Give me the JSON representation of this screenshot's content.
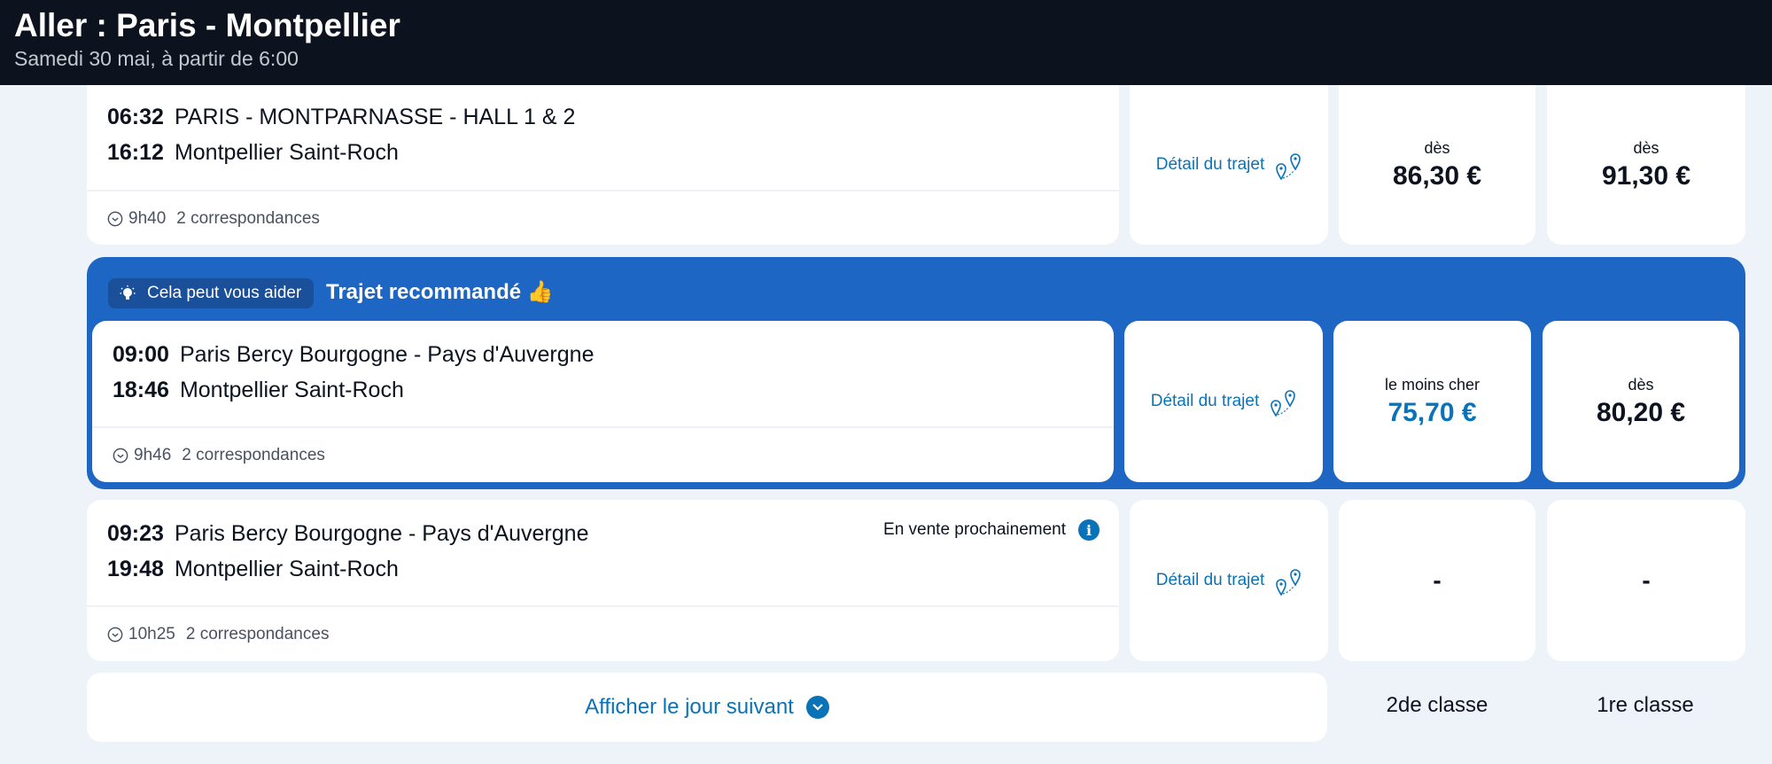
{
  "header": {
    "title": "Aller : Paris - Montpellier",
    "subtitle": "Samedi 30 mai, à partir de 6:00"
  },
  "journeys": [
    {
      "depart_time": "06:32",
      "depart_station": "PARIS - MONTPARNASSE - HALL 1 & 2",
      "arrive_time": "16:12",
      "arrive_station": "Montpellier Saint-Roch",
      "duration": "9h40",
      "connections": "2 correspondances",
      "detail_label": "Détail du trajet",
      "price_2nd": {
        "label": "dès",
        "amount": "86,30 €"
      },
      "price_1st": {
        "label": "dès",
        "amount": "91,30 €"
      }
    },
    {
      "depart_time": "09:00",
      "depart_station": "Paris Bercy Bourgogne - Pays d'Auvergne",
      "arrive_time": "18:46",
      "arrive_station": "Montpellier Saint-Roch",
      "duration": "9h46",
      "connections": "2 correspondances",
      "detail_label": "Détail du trajet",
      "price_2nd": {
        "label": "le moins cher",
        "amount": "75,70 €"
      },
      "price_1st": {
        "label": "dès",
        "amount": "80,20 €"
      }
    },
    {
      "depart_time": "09:23",
      "depart_station": "Paris Bercy Bourgogne - Pays d'Auvergne",
      "arrive_time": "19:48",
      "arrive_station": "Montpellier Saint-Roch",
      "duration": "10h25",
      "connections": "2 correspondances",
      "detail_label": "Détail du trajet",
      "sale_note": "En vente prochainement",
      "price_2nd": {
        "amount": "-"
      },
      "price_1st": {
        "amount": "-"
      }
    }
  ],
  "recommendation": {
    "help_badge": "Cela peut vous aider",
    "title": "Trajet recommandé 👍"
  },
  "footer": {
    "next_day": "Afficher le jour suivant",
    "class_2nd": "2de classe",
    "class_1st": "1re classe"
  },
  "colors": {
    "topbar": "#0c131f",
    "accent_blue": "#0a73b7",
    "recommend_band": "#1d66c4",
    "page_bg": "#eef3fa"
  }
}
